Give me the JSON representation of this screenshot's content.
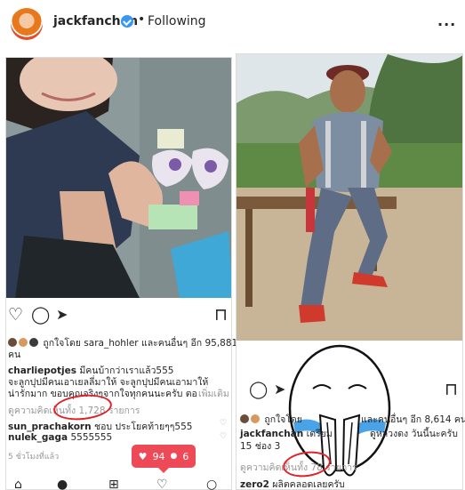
{
  "header": {
    "username": "jackfanchan",
    "separator": "•",
    "follow_status": "Following",
    "more_icon": "..."
  },
  "left_post": {
    "likes": "ถูกใจโดย sara_hohler และคนอื่นๆ อีก 95,881",
    "likes_unit": "คน",
    "comments": [
      {
        "user": "charliepotjes",
        "text": "มีคนบ้ากว่าเราแล้ว555"
      },
      {
        "user": "",
        "text": "จะลูกปุปมีคนเอาเยลลี่มาให้ จะลูกปุปมีคนเอามาให้"
      },
      {
        "user": "",
        "text": "น่ารักมาก ขอบคุณจริงๆจากใจทุกคนนะครับ ตอนนี้..."
      }
    ],
    "see_more": "เพิ่มเติม",
    "view_all_comments": "ดูความคิดเห็นทั้ง 1,728 รายการ",
    "extra_comments": [
      {
        "user": "sun_prachakorn",
        "text": "ชอบ ประโยคท้ายๆๆ555"
      },
      {
        "user": "nulek_gaga",
        "text": "5555555"
      }
    ],
    "time_ago": "5 ชั่วโมงที่แล้ว"
  },
  "right_post": {
    "likes": "ถูกใจโดย ",
    "likes_end": "และคนอื่นๆ อีก 8,614 คน",
    "caption_user": "jackfanchan",
    "caption_text": "เตรียม",
    "caption_tail": "ดูหลวงดง วันนี้นะครับ",
    "caption_line2": "15 ช่อง 3 ",
    "view_all_comments": "ดูความคิดเห็นทั้ง 78 รายการ",
    "last_comment_user": "zero2",
    "last_comment_text": "ผลิตคลอดเลยครับ"
  },
  "notification": {
    "likes_count": "94",
    "follows_count": "6"
  },
  "icons": {
    "heart": "♡",
    "comment": "◯",
    "share": "➤",
    "bookmark": "⊓",
    "small_heart": "♡",
    "notif_heart": "♥",
    "notif_person": "●"
  },
  "colors": {
    "verified": "#3897f0",
    "notification": "#ed4956",
    "annotation_circle": "#e0222a"
  }
}
